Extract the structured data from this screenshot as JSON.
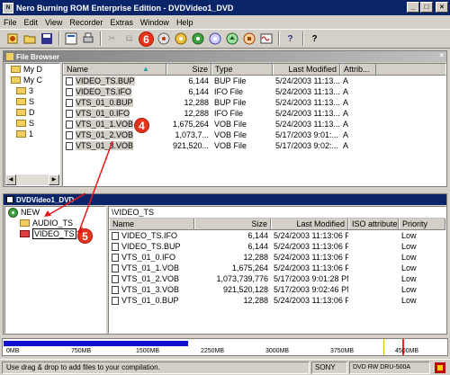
{
  "window": {
    "title": "Nero Burning ROM Enterprise Edition - DVDVideo1_DVD"
  },
  "menu": [
    "File",
    "Edit",
    "View",
    "Recorder",
    "Extras",
    "Window",
    "Help"
  ],
  "toolbar": {
    "badge": "6",
    "help_icon": "?",
    "context_help": "?"
  },
  "browser": {
    "title": "File Browser",
    "columns": [
      "Name",
      "Size",
      "Type",
      "Last Modified",
      "Attrib..."
    ],
    "tree": [
      "My D",
      "My C",
      "3",
      "S",
      "D",
      "S",
      "1"
    ],
    "files": [
      {
        "name": "VIDEO_TS.BUP",
        "size": "6,144",
        "type": "BUP File",
        "modified": "5/24/2003 11:13...",
        "attr": "A"
      },
      {
        "name": "VIDEO_TS.IFO",
        "size": "6,144",
        "type": "IFO File",
        "modified": "5/24/2003 11:13...",
        "attr": "A"
      },
      {
        "name": "VTS_01_0.BUP",
        "size": "12,288",
        "type": "BUP File",
        "modified": "5/24/2003 11:13...",
        "attr": "A"
      },
      {
        "name": "VTS_01_0.IFO",
        "size": "12,288",
        "type": "IFO File",
        "modified": "5/24/2003 11:13...",
        "attr": "A"
      },
      {
        "name": "VTS_01_1.VOB",
        "size": "1,675,264",
        "type": "VOB File",
        "modified": "5/24/2003 11:13...",
        "attr": "A"
      },
      {
        "name": "VTS_01_2.VOB",
        "size": "1,073,7...",
        "type": "VOB File",
        "modified": "5/17/2003 9:01:...",
        "attr": "A"
      },
      {
        "name": "VTS_01_3.VOB",
        "size": "921,520...",
        "type": "VOB File",
        "modified": "5/17/2003 9:02:...",
        "attr": "A"
      }
    ],
    "badge": "4"
  },
  "compilation": {
    "title": "DVDVideo1_DVD",
    "tree": {
      "root": "NEW",
      "children": [
        "AUDIO_TS",
        "VIDEO_TS"
      ]
    },
    "path": "\\VIDEO_TS",
    "badge": "5",
    "columns": [
      "Name",
      "Size",
      "Last Modified",
      "ISO attribute",
      "Priority"
    ],
    "files": [
      {
        "name": "VIDEO_TS.IFO",
        "size": "6,144",
        "modified": "5/24/2003 11:13:06 PM",
        "priority": "Low"
      },
      {
        "name": "VIDEO_TS.BUP",
        "size": "6,144",
        "modified": "5/24/2003 11:13:06 PM",
        "priority": "Low"
      },
      {
        "name": "VTS_01_0.IFO",
        "size": "12,288",
        "modified": "5/24/2003 11:13:06 PM",
        "priority": "Low"
      },
      {
        "name": "VTS_01_1.VOB",
        "size": "1,675,264",
        "modified": "5/24/2003 11:13:06 PM",
        "priority": "Low"
      },
      {
        "name": "VTS_01_2.VOB",
        "size": "1,073,739,776",
        "modified": "5/17/2003 9:01:28 PM",
        "priority": "Low"
      },
      {
        "name": "VTS_01_3.VOB",
        "size": "921,520,128",
        "modified": "5/17/2003 9:02:46 PM",
        "priority": "Low"
      },
      {
        "name": "VTS_01_0.BUP",
        "size": "12,288",
        "modified": "5/24/2003 11:13:06 PM",
        "priority": "Low"
      }
    ]
  },
  "capacity": {
    "fill_fraction": 0.415,
    "ticks": [
      "0MB",
      "750MB",
      "1500MB",
      "2250MB",
      "3000MB",
      "3750MB",
      "4500MB"
    ]
  },
  "status": {
    "message": "Use drag & drop to add files to your compilation.",
    "vendor": "SONY",
    "drive": "DVD RW DRU-500A"
  }
}
